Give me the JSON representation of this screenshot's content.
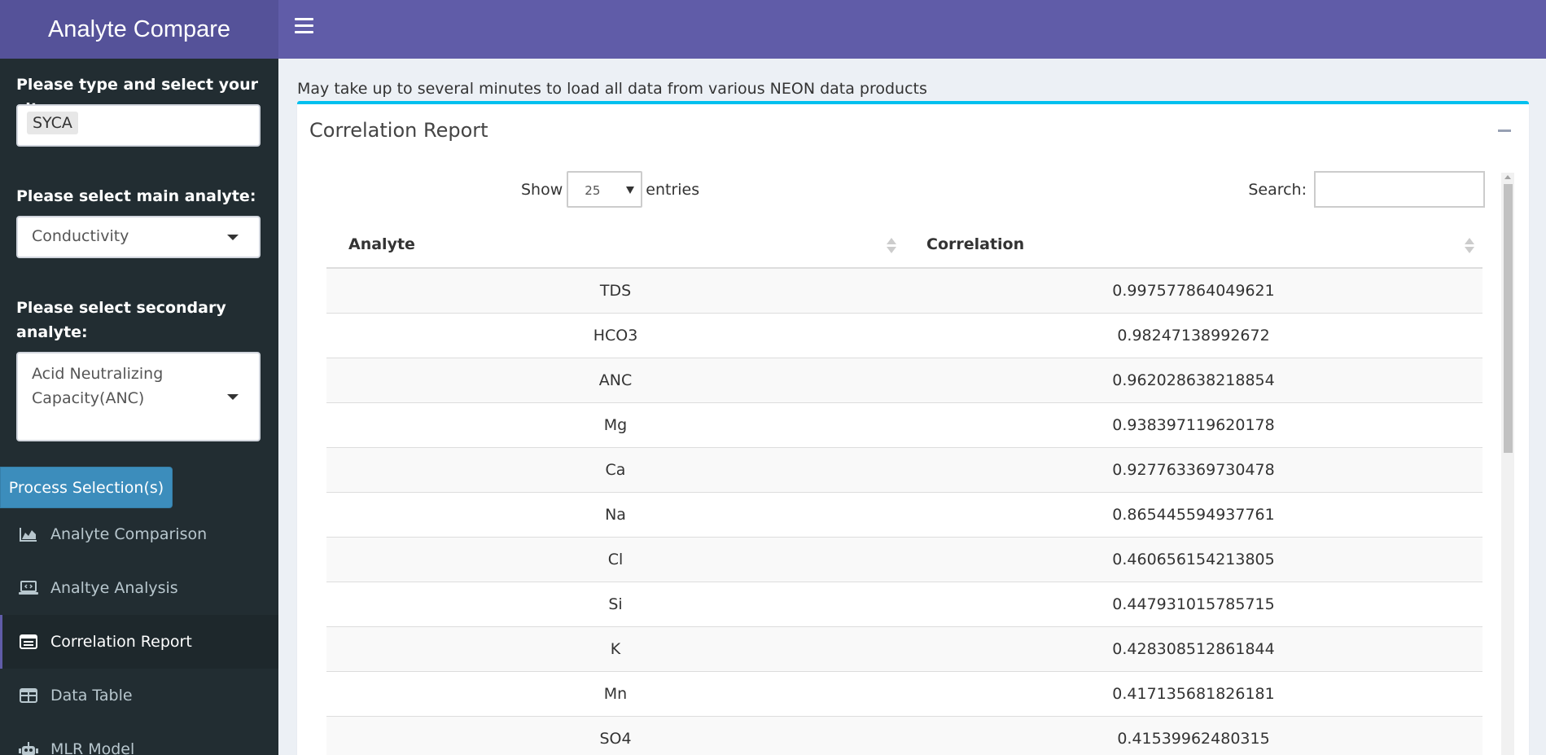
{
  "app": {
    "title": "Analyte Compare"
  },
  "sidebar": {
    "site_label": "Please type and select your site:",
    "site_value": "SYCA",
    "main_label": "Please select main analyte:",
    "main_value": "Conductivity",
    "secondary_label_line1": "Please select secondary",
    "secondary_label_line2": "analyte:",
    "secondary_value_line1": "Acid Neutralizing",
    "secondary_value_line2": "Capacity(ANC)",
    "process_button": "Process Selection(s)",
    "menu": [
      {
        "label": "Analyte Comparison",
        "icon": "area-chart-icon"
      },
      {
        "label": "Analtye Analysis",
        "icon": "laptop-code-icon"
      },
      {
        "label": "Correlation Report",
        "icon": "table-icon"
      },
      {
        "label": "Data Table",
        "icon": "grid-icon"
      },
      {
        "label": "MLR Model",
        "icon": "robot-icon"
      }
    ]
  },
  "content": {
    "notice": "May take up to several minutes to load all data from various NEON data products",
    "box_title": "Correlation Report",
    "show_label": "Show",
    "entries_value": "25",
    "entries_label": "entries",
    "search_label": "Search:",
    "columns": [
      "Analyte",
      "Correlation"
    ],
    "rows": [
      [
        "TDS",
        "0.997577864049621"
      ],
      [
        "HCO3",
        "0.98247138992672"
      ],
      [
        "ANC",
        "0.962028638218854"
      ],
      [
        "Mg",
        "0.938397119620178"
      ],
      [
        "Ca",
        "0.927763369730478"
      ],
      [
        "Na",
        "0.865445594937761"
      ],
      [
        "Cl",
        "0.460656154213805"
      ],
      [
        "Si",
        "0.447931015785715"
      ],
      [
        "K",
        "0.428308512861844"
      ],
      [
        "Mn",
        "0.417135681826181"
      ],
      [
        "SO4",
        "0.41539962480315"
      ]
    ]
  },
  "colors": {
    "header": "#605ca8",
    "logo": "#555299",
    "sidebar": "#222d32",
    "box_accent": "#00c0ef",
    "button": "#3c8dbc"
  }
}
